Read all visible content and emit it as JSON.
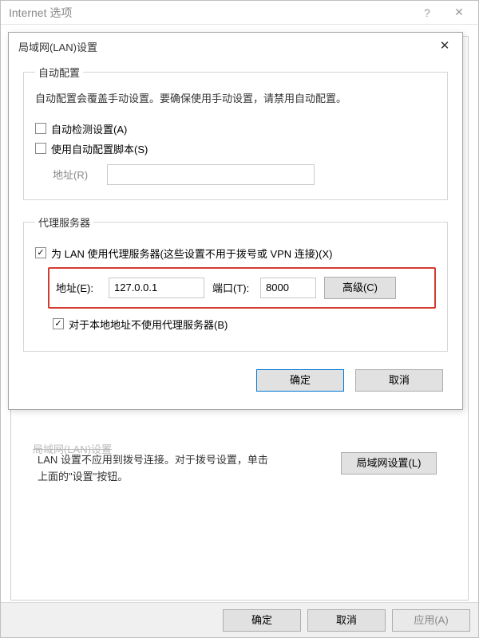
{
  "parent": {
    "title": "Internet 选项",
    "help_icon": "?",
    "close_icon": "✕",
    "lan_section_partial": "局域网(LAN)设置",
    "lan_text": "LAN 设置不应用到拨号连接。对于拨号设置，单击上面的\"设置\"按钮。",
    "lan_button": "局域网设置(L)",
    "ok": "确定",
    "cancel": "取消",
    "apply": "应用(A)"
  },
  "dialog": {
    "title": "局域网(LAN)设置",
    "close_icon": "✕",
    "auto": {
      "legend": "自动配置",
      "hint": "自动配置会覆盖手动设置。要确保使用手动设置，请禁用自动配置。",
      "auto_detect_checked": false,
      "auto_detect_label": "自动检测设置(A)",
      "use_script_checked": false,
      "use_script_label": "使用自动配置脚本(S)",
      "addr_label": "地址(R)",
      "addr_value": ""
    },
    "proxy": {
      "legend": "代理服务器",
      "use_proxy_checked": true,
      "use_proxy_label": "为 LAN 使用代理服务器(这些设置不用于拨号或 VPN 连接)(X)",
      "addr_label": "地址(E):",
      "addr_value": "127.0.0.1",
      "port_label": "端口(T):",
      "port_value": "8000",
      "advanced": "高级(C)",
      "bypass_checked": true,
      "bypass_label": "对于本地地址不使用代理服务器(B)"
    },
    "ok": "确定",
    "cancel": "取消"
  }
}
